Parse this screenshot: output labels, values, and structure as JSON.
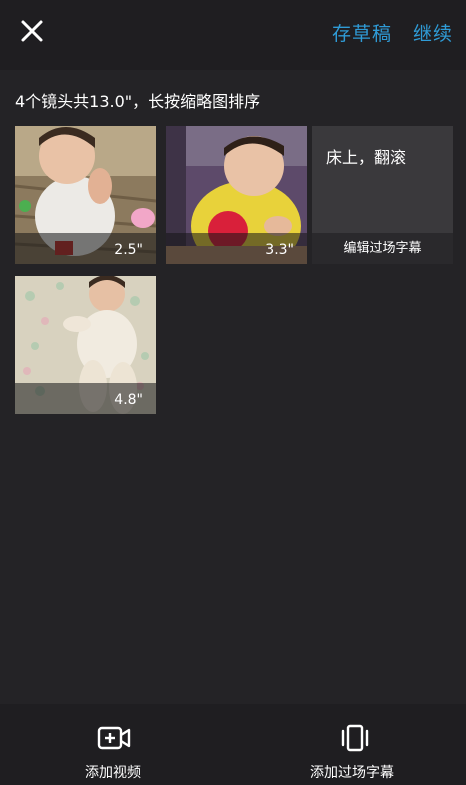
{
  "header": {
    "close_icon": "close-icon",
    "save_draft_label": "存草稿",
    "continue_label": "继续",
    "accent_color": "#2f9bd6"
  },
  "info_text": "4个镜头共13.0\"，长按缩略图排序",
  "clips": [
    {
      "duration": "2.5\""
    },
    {
      "duration": "3.3\""
    },
    {
      "duration": "4.8\""
    }
  ],
  "title_card": {
    "text": "床上，翻滚",
    "edit_label": "编辑过场字幕"
  },
  "bottom_bar": {
    "add_video_label": "添加视频",
    "add_video_icon": "video-plus-icon",
    "add_title_label": "添加过场字幕",
    "add_title_icon": "phone-frame-icon"
  }
}
